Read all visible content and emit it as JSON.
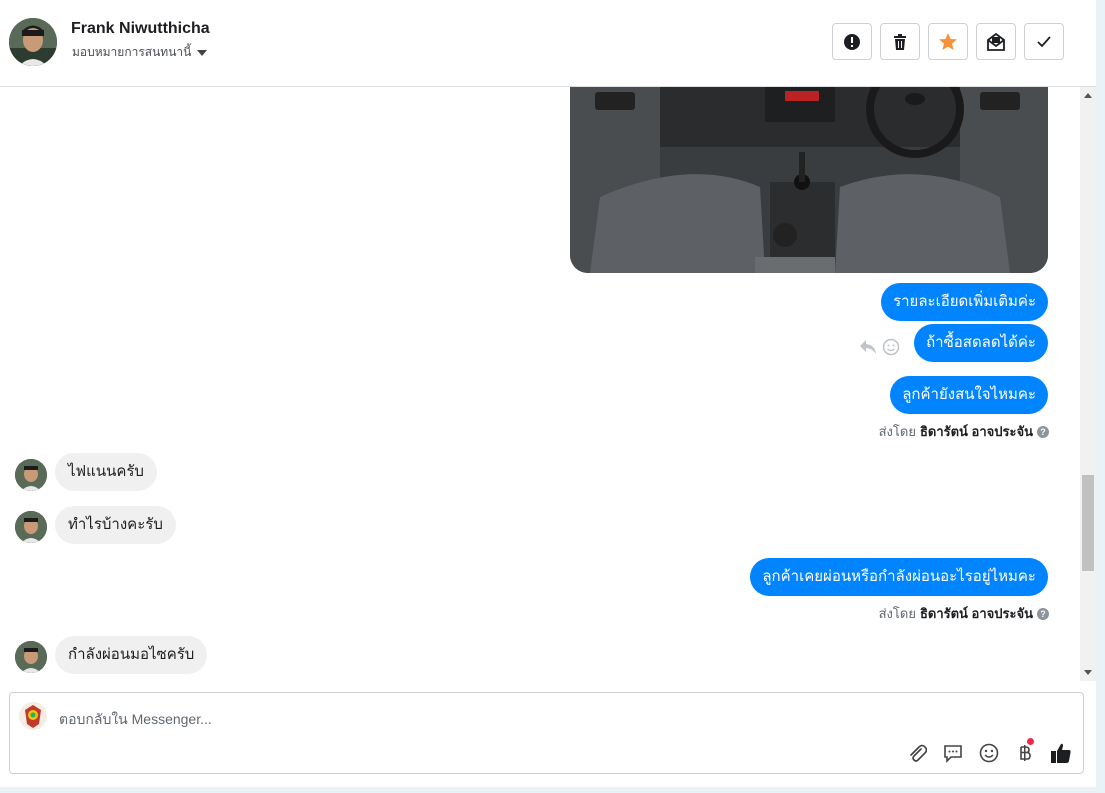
{
  "header": {
    "name": "Frank Niwutthicha",
    "assign_label": "มอบหมายการสนทนานี้",
    "actions": [
      "spam-icon",
      "trash-icon",
      "star-icon",
      "unread-mail-icon",
      "check-icon"
    ]
  },
  "messages": {
    "out_1": "รายละเอียดเพิ่มเติมค่ะ",
    "out_2": "ถ้าซื้อสดลดได้ค่ะ",
    "out_3": "ลูกค้ายังสนใจไหมคะ",
    "sent_by_1": {
      "prefix": "ส่งโดย",
      "agent": "ธิดารัตน์ อาจประจัน"
    },
    "in_1": "ไฟแนนครับ",
    "in_2": "ทำไรบ้างคะรับ",
    "out_4": "ลูกค้าเคยผ่อนหรือกำลังผ่อนอะไรอยู่ไหมคะ",
    "sent_by_2": {
      "prefix": "ส่งโดย",
      "agent": "ธิดารัตน์ อาจประจัน"
    },
    "in_3": "กำลังผ่อนมอไซครับ"
  },
  "composer": {
    "placeholder": "ตอบกลับใน Messenger...",
    "tools": [
      "paperclip-icon",
      "saved-reply-icon",
      "emoji-icon",
      "baht-payment-icon",
      "thumbs-up-icon"
    ]
  },
  "colors": {
    "accent": "#0084ff",
    "star": "#f7923a",
    "incoming_bubble": "#f1f0f0"
  }
}
